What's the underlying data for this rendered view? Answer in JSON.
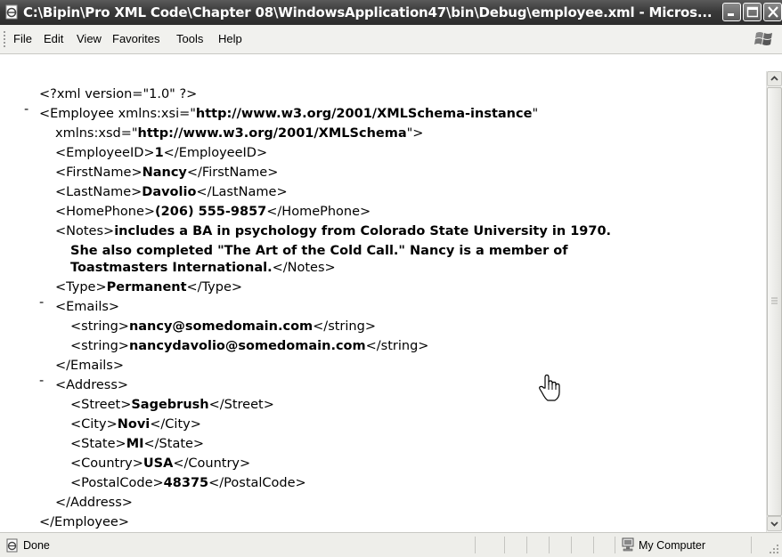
{
  "window": {
    "title": "C:\\Bipin\\Pro XML Code\\Chapter 08\\WindowsApplication47\\bin\\Debug\\employee.xml - Micros...",
    "icons": [
      "ie-page-icon",
      "minimize-icon",
      "maximize-icon",
      "close-icon"
    ]
  },
  "menu": {
    "file": "File",
    "edit": "Edit",
    "view": "View",
    "favorites": "Favorites",
    "tools": "Tools",
    "help": "Help"
  },
  "xml": {
    "l1": "<?xml version=\"1.0\" ?>",
    "l2a": "<Employee xmlns:xsi=\"",
    "l2b": "http://www.w3.org/2001/XMLSchema-instance",
    "l2c": "\"",
    "l3a": "xmlns:xsd=\"",
    "l3b": "http://www.w3.org/2001/XMLSchema",
    "l3c": "\">",
    "l4a": "<EmployeeID>",
    "l4b": "1",
    "l4c": "</EmployeeID>",
    "l5a": "<FirstName>",
    "l5b": "Nancy",
    "l5c": "</FirstName>",
    "l6a": "<LastName>",
    "l6b": "Davolio",
    "l6c": "</LastName>",
    "l7a": "<HomePhone>",
    "l7b": "(206) 555-9857",
    "l7c": "</HomePhone>",
    "l8a": "<Notes>",
    "l8b": "includes a BA in psychology from Colorado State University in 1970.",
    "l9": "She also completed \"The Art of the Cold Call.\" Nancy is a member of",
    "l10a": "Toastmasters International.",
    "l10b": "</Notes>",
    "l11a": "<Type>",
    "l11b": "Permanent",
    "l11c": "</Type>",
    "l12": "<Emails>",
    "l13a": "<string>",
    "l13b": "nancy@somedomain.com",
    "l13c": "</string>",
    "l14a": "<string>",
    "l14b": "nancydavolio@somedomain.com",
    "l14c": "</string>",
    "l15": "</Emails>",
    "l16": "<Address>",
    "l17a": "<Street>",
    "l17b": "Sagebrush",
    "l17c": "</Street>",
    "l18a": "<City>",
    "l18b": "Novi",
    "l18c": "</City>",
    "l19a": "<State>",
    "l19b": "MI",
    "l19c": "</State>",
    "l20a": "<Country>",
    "l20b": "USA",
    "l20c": "</Country>",
    "l21a": "<PostalCode>",
    "l21b": "48375",
    "l21c": "</PostalCode>",
    "l22": "</Address>",
    "l23": "</Employee>",
    "collapse": "-"
  },
  "status": {
    "left": "Done",
    "zone": "My Computer"
  }
}
